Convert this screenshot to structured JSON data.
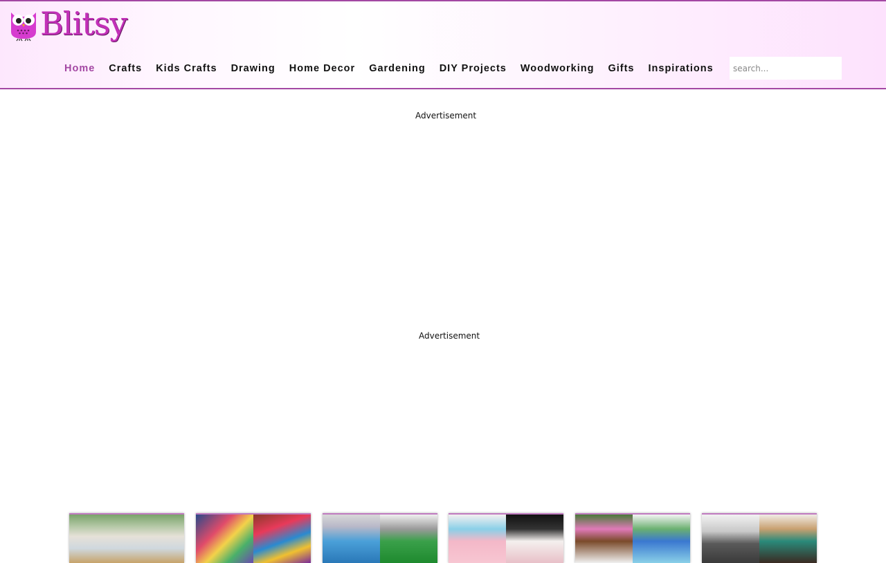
{
  "site": {
    "logo_text": "Blitsy"
  },
  "nav": {
    "items": [
      {
        "label": "Home"
      },
      {
        "label": "Crafts"
      },
      {
        "label": "Kids Crafts"
      },
      {
        "label": "Drawing"
      },
      {
        "label": "Home Decor"
      },
      {
        "label": "Gardening"
      },
      {
        "label": "DIY Projects"
      },
      {
        "label": "Woodworking"
      },
      {
        "label": "Gifts"
      },
      {
        "label": "Inspirations"
      }
    ],
    "active": "Home"
  },
  "search": {
    "placeholder": "search..."
  },
  "ads": {
    "label_1": "Advertisement",
    "label_2": "Advertisement"
  },
  "colors": {
    "brand": "#c230b8",
    "accent": "#a347a3"
  }
}
